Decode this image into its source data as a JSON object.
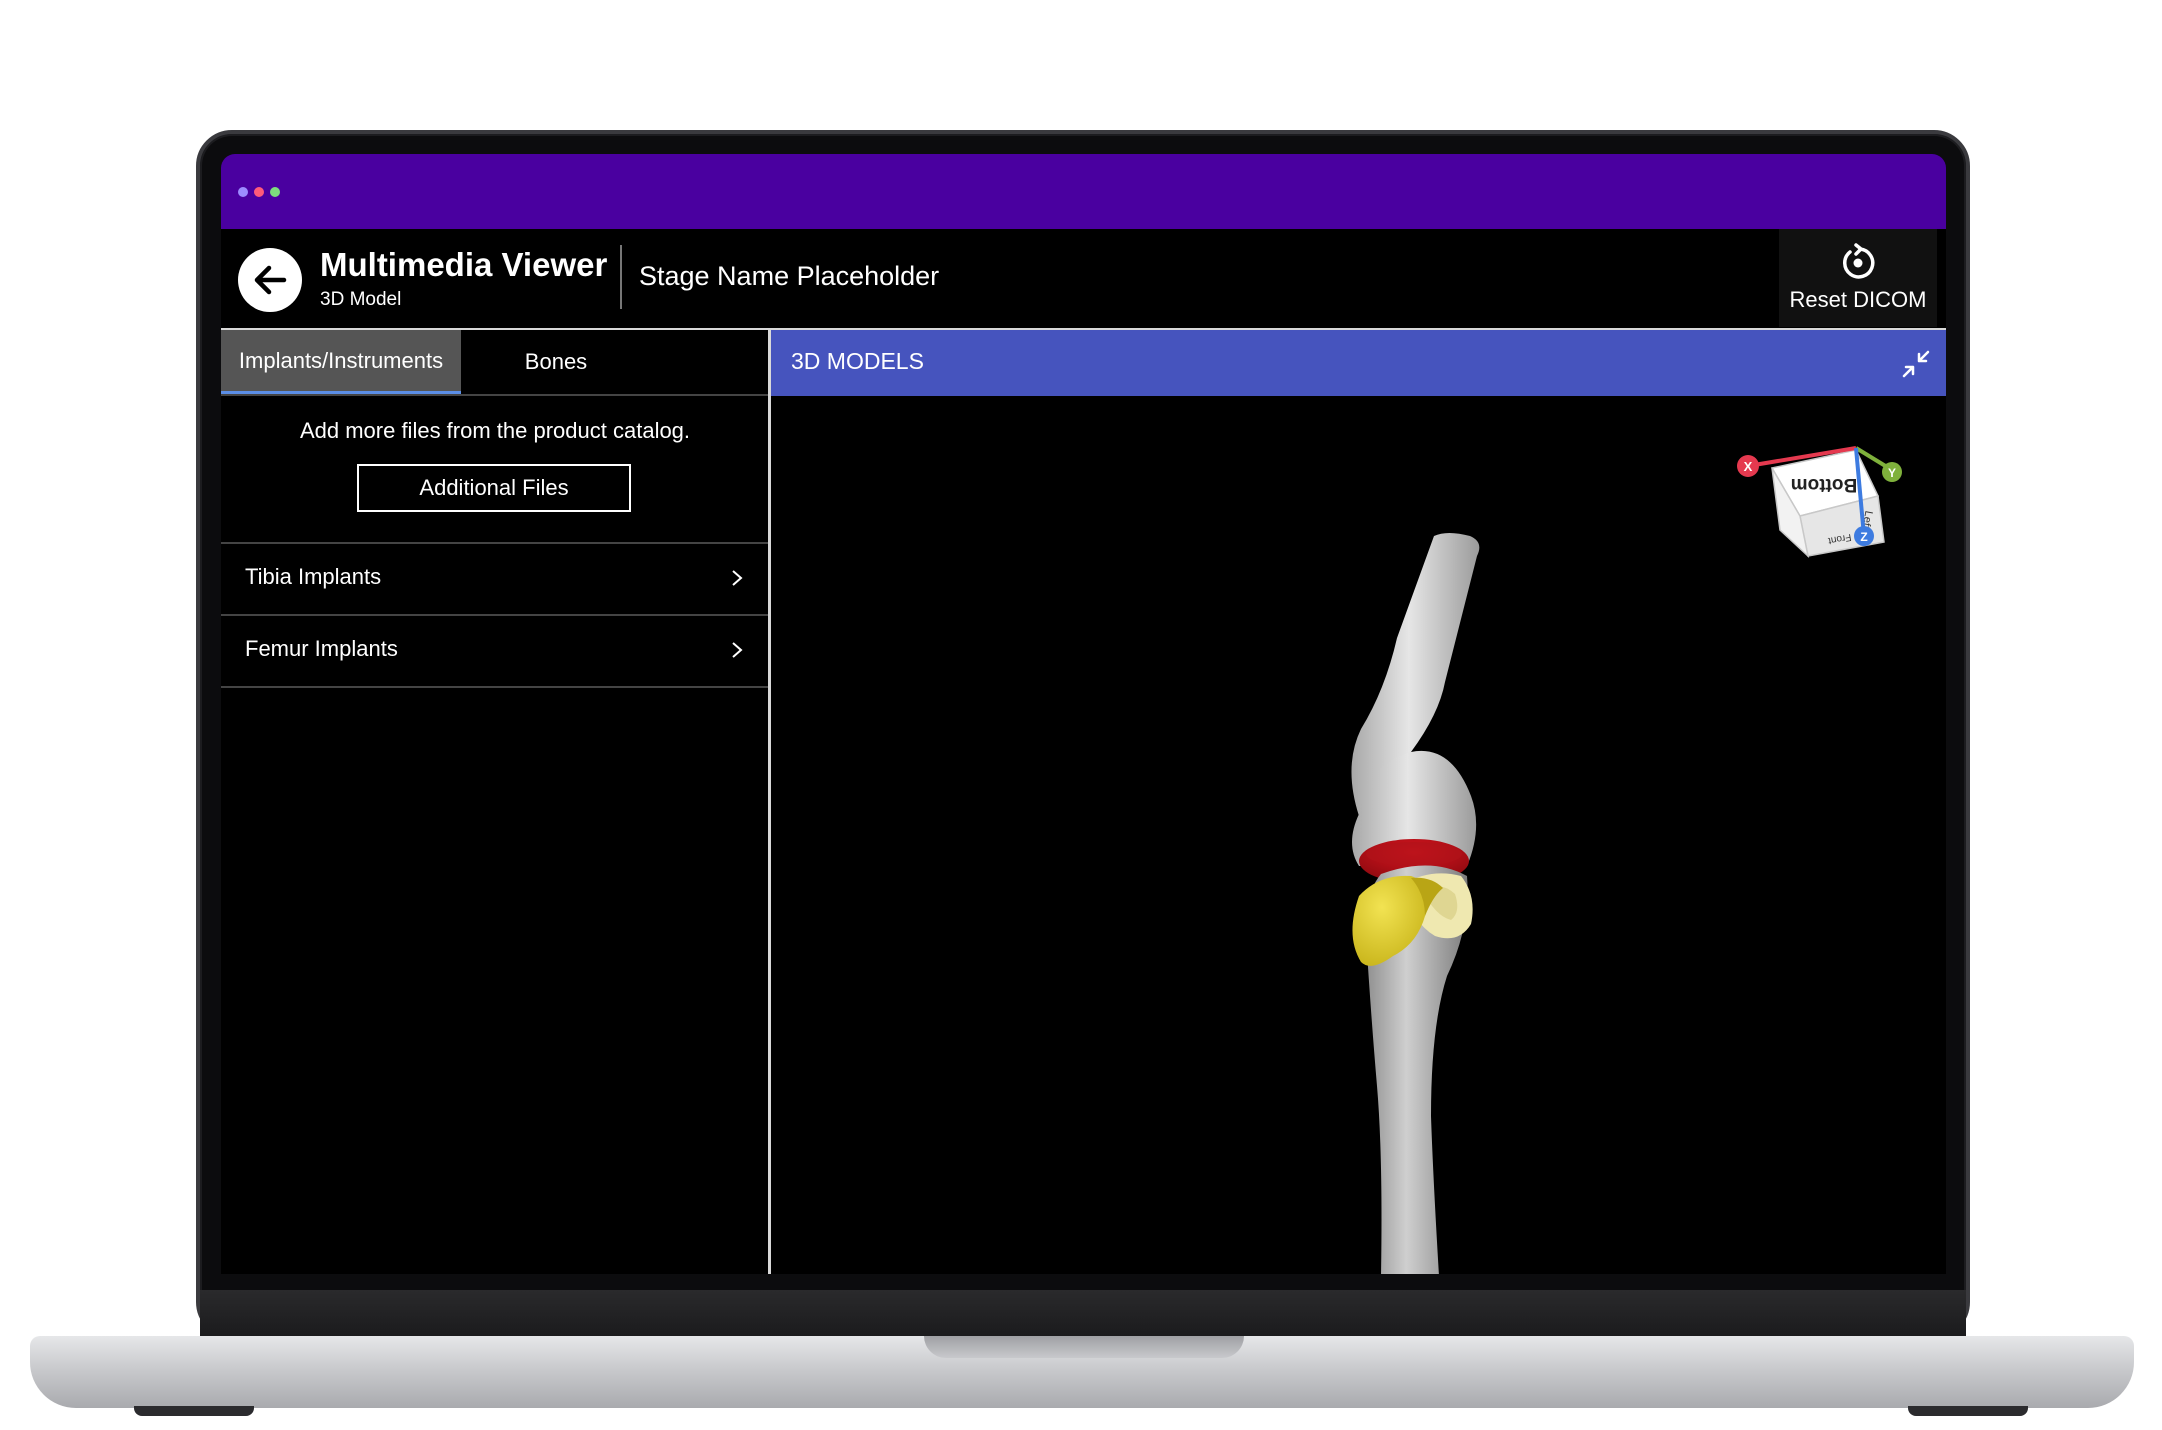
{
  "window": {
    "dots": [
      "#9d8cff",
      "#ff5a7a",
      "#7ddc7d"
    ]
  },
  "header": {
    "title": "Multimedia Viewer",
    "subtitle": "3D Model",
    "stage_name": "Stage Name Placeholder",
    "reset_label": "Reset DICOM"
  },
  "sidebar": {
    "tabs": [
      {
        "label": "Implants/Instruments",
        "active": true
      },
      {
        "label": "Bones",
        "active": false
      }
    ],
    "catalog_text": "Add more files from the product catalog.",
    "additional_files_label": "Additional Files",
    "items": [
      {
        "label": "Tibia Implants"
      },
      {
        "label": "Femur Implants"
      }
    ]
  },
  "viewer": {
    "title": "3D MODELS",
    "header_color": "#4654be",
    "cube": {
      "face_top": "Bottom",
      "face_side": "Left",
      "face_front": "Front",
      "axis_x": "X",
      "axis_y": "Y",
      "axis_z": "Z",
      "axis_x_color": "#e5394f",
      "axis_y_color": "#7fb13c",
      "axis_z_color": "#3d7be0"
    }
  },
  "colors": {
    "titlebar": "#4a00a0",
    "bone": "#d9d9d9",
    "tibial_implant": "#c8101a",
    "patella_implant": "#e3d12e"
  }
}
